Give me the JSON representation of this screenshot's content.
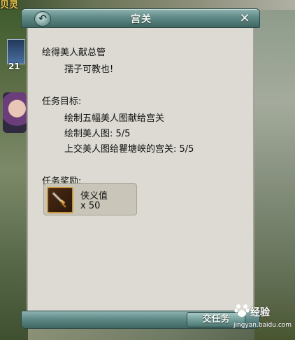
{
  "game": {
    "top_left_text": "贝灵",
    "hud_count": "21"
  },
  "dialog": {
    "title": "宫关",
    "back_icon": "back-arrow-icon",
    "close_icon": "close-icon",
    "intro_heading": "绘得美人献总管",
    "intro_text": "孺子可教也!",
    "objective_heading": "任务目标:",
    "objective_title": "绘制五幅美人图献给宫关",
    "objectives": [
      "绘制美人图: 5/5",
      "上交美人图给瞿塘峡的宫关: 5/5"
    ],
    "reward_heading": "任务奖励:",
    "reward": {
      "icon": "dagger-icon",
      "name": "侠义值",
      "quantity": "x 50"
    },
    "submit_label": "交任务"
  },
  "watermark": {
    "brand": "经验",
    "url": "jingyan.baidu.com"
  },
  "colors": {
    "panel_bg": "#dcdad2",
    "frame_teal": "#5f8a87",
    "text": "#111111"
  }
}
